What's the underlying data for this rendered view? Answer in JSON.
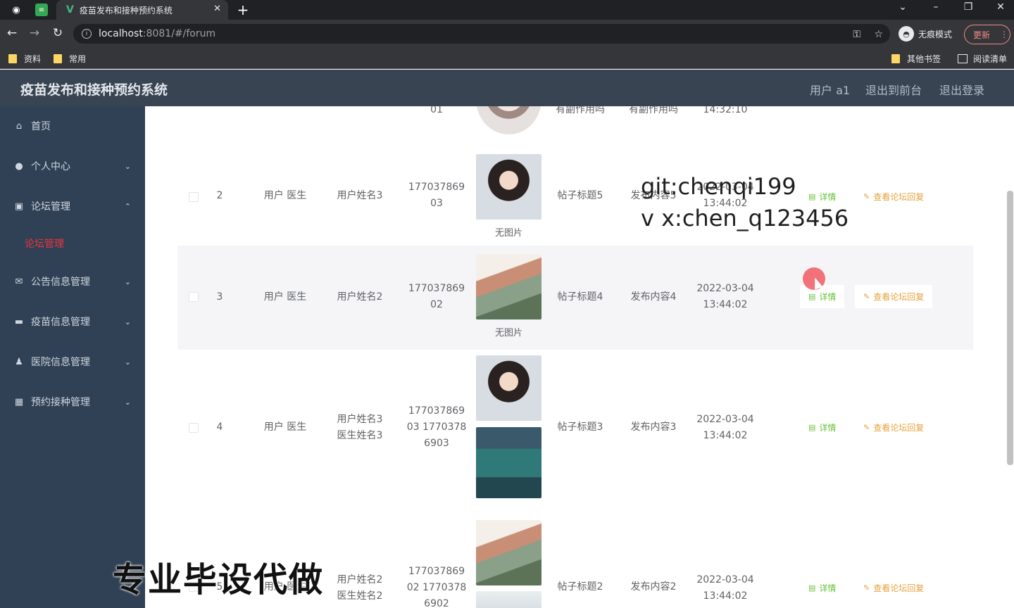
{
  "browser": {
    "tab_title": "疫苗发布和接种预约系统",
    "url_host": "localhost",
    "url_rest": ":8081/#/forum",
    "incognito_label": "无痕模式",
    "update_label": "更新",
    "bookmarks": [
      "资料",
      "常用"
    ],
    "other_bookmarks": "其他书签",
    "reading_list": "阅读清单"
  },
  "header": {
    "title": "疫苗发布和接种预约系统",
    "user": "用户 a1",
    "back_front": "退出到前台",
    "logout": "退出登录"
  },
  "sidebar": {
    "items": [
      {
        "label": "首页",
        "icon": "home-icon"
      },
      {
        "label": "个人中心",
        "icon": "user-icon"
      },
      {
        "label": "论坛管理",
        "icon": "chart-icon"
      },
      {
        "label": "公告信息管理",
        "icon": "mail-icon"
      },
      {
        "label": "疫苗信息管理",
        "icon": "vaccine-icon"
      },
      {
        "label": "医院信息管理",
        "icon": "person-icon"
      },
      {
        "label": "预约接种管理",
        "icon": "grid-icon"
      }
    ],
    "active_sub": "论坛管理"
  },
  "table": {
    "partial_top": {
      "phone_tail": "01",
      "title": "有副作用吗",
      "content": "有副作用吗",
      "time": "14:32:10"
    },
    "rows": [
      {
        "index": "2",
        "role": "用户 医生",
        "name": "用户姓名3",
        "phone_line1": "177037869",
        "phone_line2": "03",
        "no_image": "无图片",
        "title": "帖子标题5",
        "content": "发布内容5",
        "date": "2022-03-04",
        "time": "13:44:02"
      },
      {
        "index": "3",
        "role": "用户 医生",
        "name": "用户姓名2",
        "phone_line1": "177037869",
        "phone_line2": "02",
        "no_image": "无图片",
        "title": "帖子标题4",
        "content": "发布内容4",
        "date": "2022-03-04",
        "time": "13:44:02"
      },
      {
        "index": "4",
        "role": "用户 医生",
        "name_line1": "用户姓名3",
        "name_line2": "医生姓名3",
        "phone_line1": "177037869",
        "phone_line2": "03 1770378",
        "phone_line3": "6903",
        "title": "帖子标题3",
        "content": "发布内容3",
        "date": "2022-03-04",
        "time": "13:44:02"
      },
      {
        "index": "5",
        "role": "用户 医生",
        "name_line1": "用户姓名2",
        "name_line2": "医生姓名2",
        "phone_line1": "177037869",
        "phone_line2": "02 1770378",
        "phone_line3": "6902",
        "title": "帖子标题2",
        "content": "发布内容2",
        "date": "2022-03-04",
        "time": "13:44:02"
      }
    ],
    "detail_label": "详情",
    "reply_label": "查看论坛回复"
  },
  "overlay": {
    "watermark_line1": "git:chenqi199",
    "watermark_line2": "v x:chen_q123456",
    "promo": "专业毕设代做"
  },
  "colors": {
    "header_bg": "#384452",
    "sidebar_bg": "#304156",
    "active_menu": "#f0323c",
    "detail": "#67c23a",
    "reply": "#e6a23c"
  }
}
